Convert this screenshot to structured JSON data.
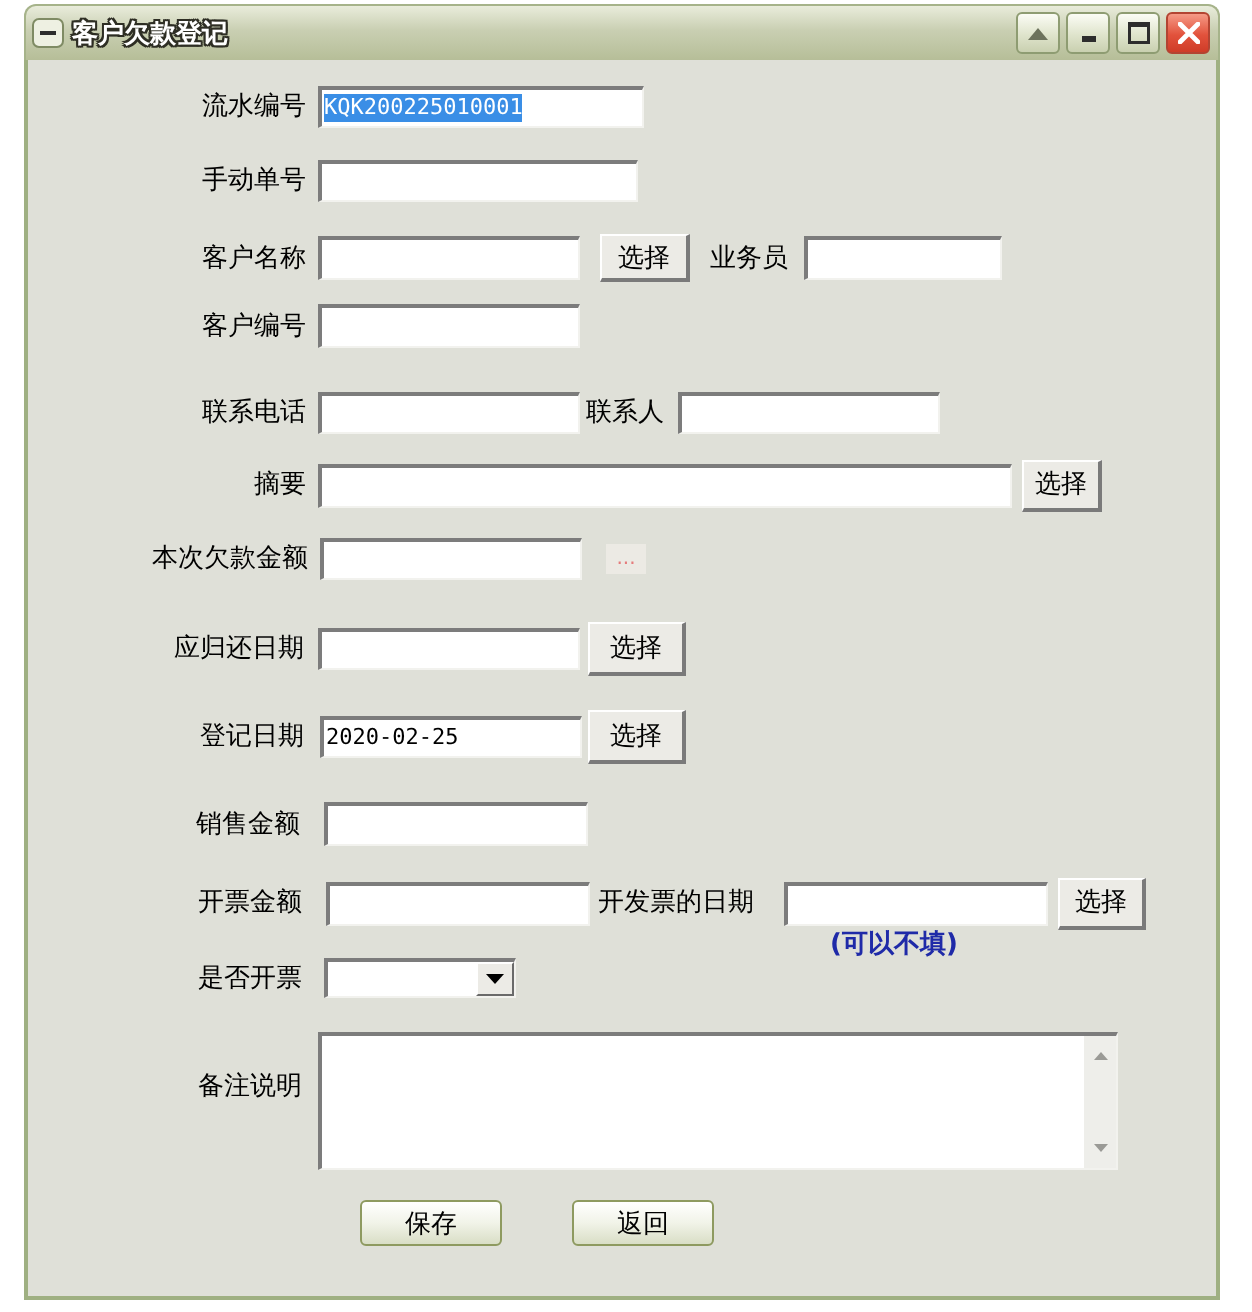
{
  "window": {
    "title": "客户欠款登记"
  },
  "form": {
    "rows": [
      {
        "items": [
          {
            "kind": "label",
            "text": "流水编号"
          },
          {
            "kind": "field",
            "value": "KQK200225010001",
            "value_selected": true
          }
        ]
      },
      {
        "items": [
          {
            "kind": "label",
            "text": "手动单号"
          },
          {
            "kind": "field"
          }
        ]
      },
      {
        "items": [
          {
            "kind": "label",
            "text": "客户名称"
          },
          {
            "kind": "field"
          },
          {
            "kind": "button",
            "label": "选择"
          },
          {
            "kind": "label",
            "text": "业务员"
          },
          {
            "kind": "field"
          }
        ]
      },
      {
        "items": [
          {
            "kind": "label",
            "text": "客户编号"
          },
          {
            "kind": "field"
          }
        ]
      },
      {
        "items": [
          {
            "kind": "label",
            "text": "联系电话"
          },
          {
            "kind": "field"
          },
          {
            "kind": "label",
            "text": "联系人"
          },
          {
            "kind": "field"
          }
        ]
      },
      {
        "items": [
          {
            "kind": "label",
            "text": "摘要"
          },
          {
            "kind": "field"
          },
          {
            "kind": "button",
            "label": "选择"
          }
        ]
      },
      {
        "items": [
          {
            "kind": "label",
            "text": "本次欠款金额"
          },
          {
            "kind": "field"
          },
          {
            "kind": "ellipsis_button",
            "label": "..."
          }
        ]
      },
      {
        "items": [
          {
            "kind": "label",
            "text": "应归还日期"
          },
          {
            "kind": "field"
          },
          {
            "kind": "button",
            "label": "选择"
          }
        ]
      },
      {
        "items": [
          {
            "kind": "label",
            "text": "登记日期"
          },
          {
            "kind": "field",
            "value": "2020-02-25",
            "value_selected": false
          },
          {
            "kind": "button",
            "label": "选择"
          }
        ]
      },
      {
        "items": [
          {
            "kind": "label",
            "text": "销售金额"
          },
          {
            "kind": "field"
          }
        ]
      },
      {
        "items": [
          {
            "kind": "label",
            "text": "开票金额"
          },
          {
            "kind": "field"
          },
          {
            "kind": "label",
            "text": "开发票的日期"
          },
          {
            "kind": "field"
          },
          {
            "kind": "button",
            "label": "选择"
          }
        ]
      },
      {
        "items": [
          {
            "kind": "hint",
            "text": "(可以不填)"
          }
        ]
      },
      {
        "items": [
          {
            "kind": "label",
            "text": "是否开票"
          },
          {
            "kind": "dropdown"
          }
        ]
      },
      {
        "items": [
          {
            "kind": "label",
            "text": "备注说明"
          },
          {
            "kind": "memo"
          }
        ]
      }
    ]
  },
  "buttons": [
    {
      "label": "保存"
    },
    {
      "label": "返回"
    }
  ]
}
